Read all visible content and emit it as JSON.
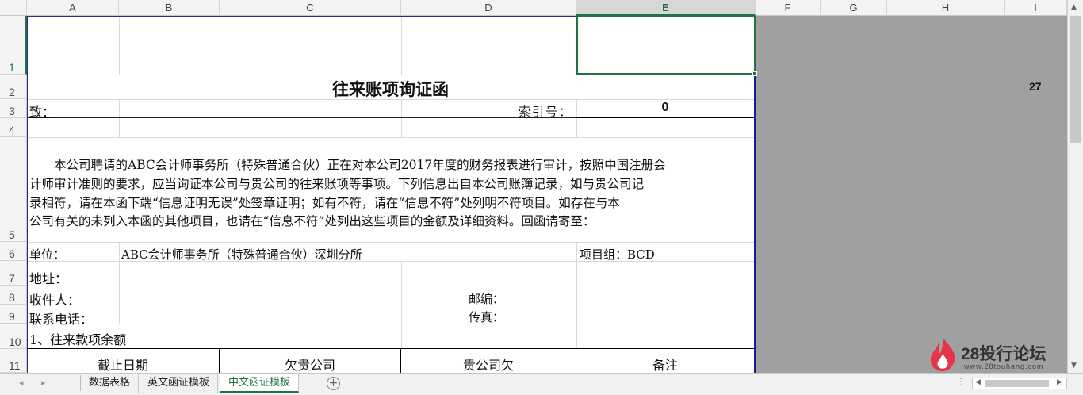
{
  "columns": [
    "A",
    "B",
    "C",
    "D",
    "E",
    "F",
    "G",
    "H",
    "I"
  ],
  "rows": [
    "1",
    "2",
    "3",
    "4",
    "5",
    "6",
    "7",
    "8",
    "9",
    "10",
    "11"
  ],
  "selected_cell": "E1",
  "sheet": {
    "title": "往来账项询证函",
    "to_label": "致：",
    "index_label": "索引号：",
    "index_value": "0",
    "side_value": "27",
    "body_lines": [
      "　　本公司聘请的ABC会计师事务所（特殊普通合伙）正在对本公司2017年度的财务报表进行审计，按照中国注册会",
      "计师审计准则的要求，应当询证本公司与贵公司的往来账项等事项。下列信息出自本公司账簿记录，如与贵公司记",
      "录相符，请在本函下端“信息证明无误”处签章证明；如有不符，请在“信息不符”处列明不符项目。如存在与本",
      "公司有关的未列入本函的其他项目，也请在“信息不符”处列出这些项目的金额及详细资料。回函请寄至："
    ],
    "unit_label": "单位：",
    "unit_value": "ABC会计师事务所（特殊普通合伙）深圳分所",
    "project_group": "项目组：BCD",
    "address_label": "地址：",
    "recipient_label": "收件人：",
    "postcode_label": "邮编：",
    "phone_label": "联系电话：",
    "fax_label": "传真：",
    "section1": "1、往来款项余额",
    "table_headers": [
      "截止日期",
      "欠贵公司",
      "贵公司欠",
      "备注"
    ]
  },
  "tabs": [
    "数据表格",
    "英文函证模板",
    "中文函证模板"
  ],
  "active_tab": "中文函证模板",
  "watermark": {
    "brand": "28投行论坛",
    "site": "www.28touhang.com"
  }
}
